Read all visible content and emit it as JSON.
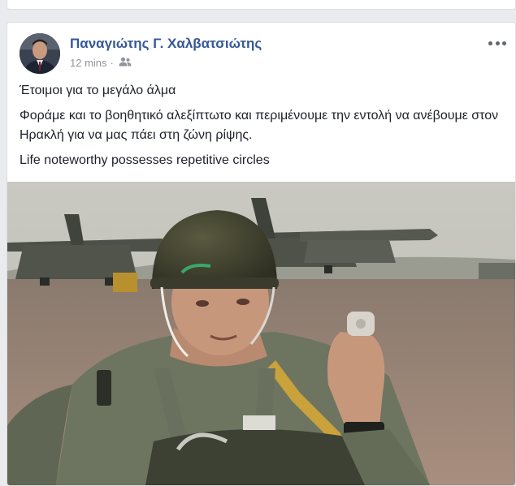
{
  "post": {
    "author": "Παναγιώτης Γ. Χαλβατσιώτης",
    "time": "12 mins",
    "separator": "·",
    "privacy_icon": "friends-audience-icon",
    "more_icon": "more-options-icon",
    "paragraphs": [
      "Έτοιμοι για το μεγάλο άλμα",
      "Φοράμε και το βοηθητικό αλεξίπτωτο και περιμένουμε την εντολή να ανέβουμε στον Ηρακλή για να μας πάει στη ζώνη ρίψης.",
      "Life noteworthy possesses repetitive circles"
    ],
    "photo_subject": "paratrooper-photo"
  },
  "colors": {
    "author_link": "#365899",
    "meta_text": "#90949c",
    "body_text": "#1d2129",
    "page_bg": "#e9ebee"
  }
}
